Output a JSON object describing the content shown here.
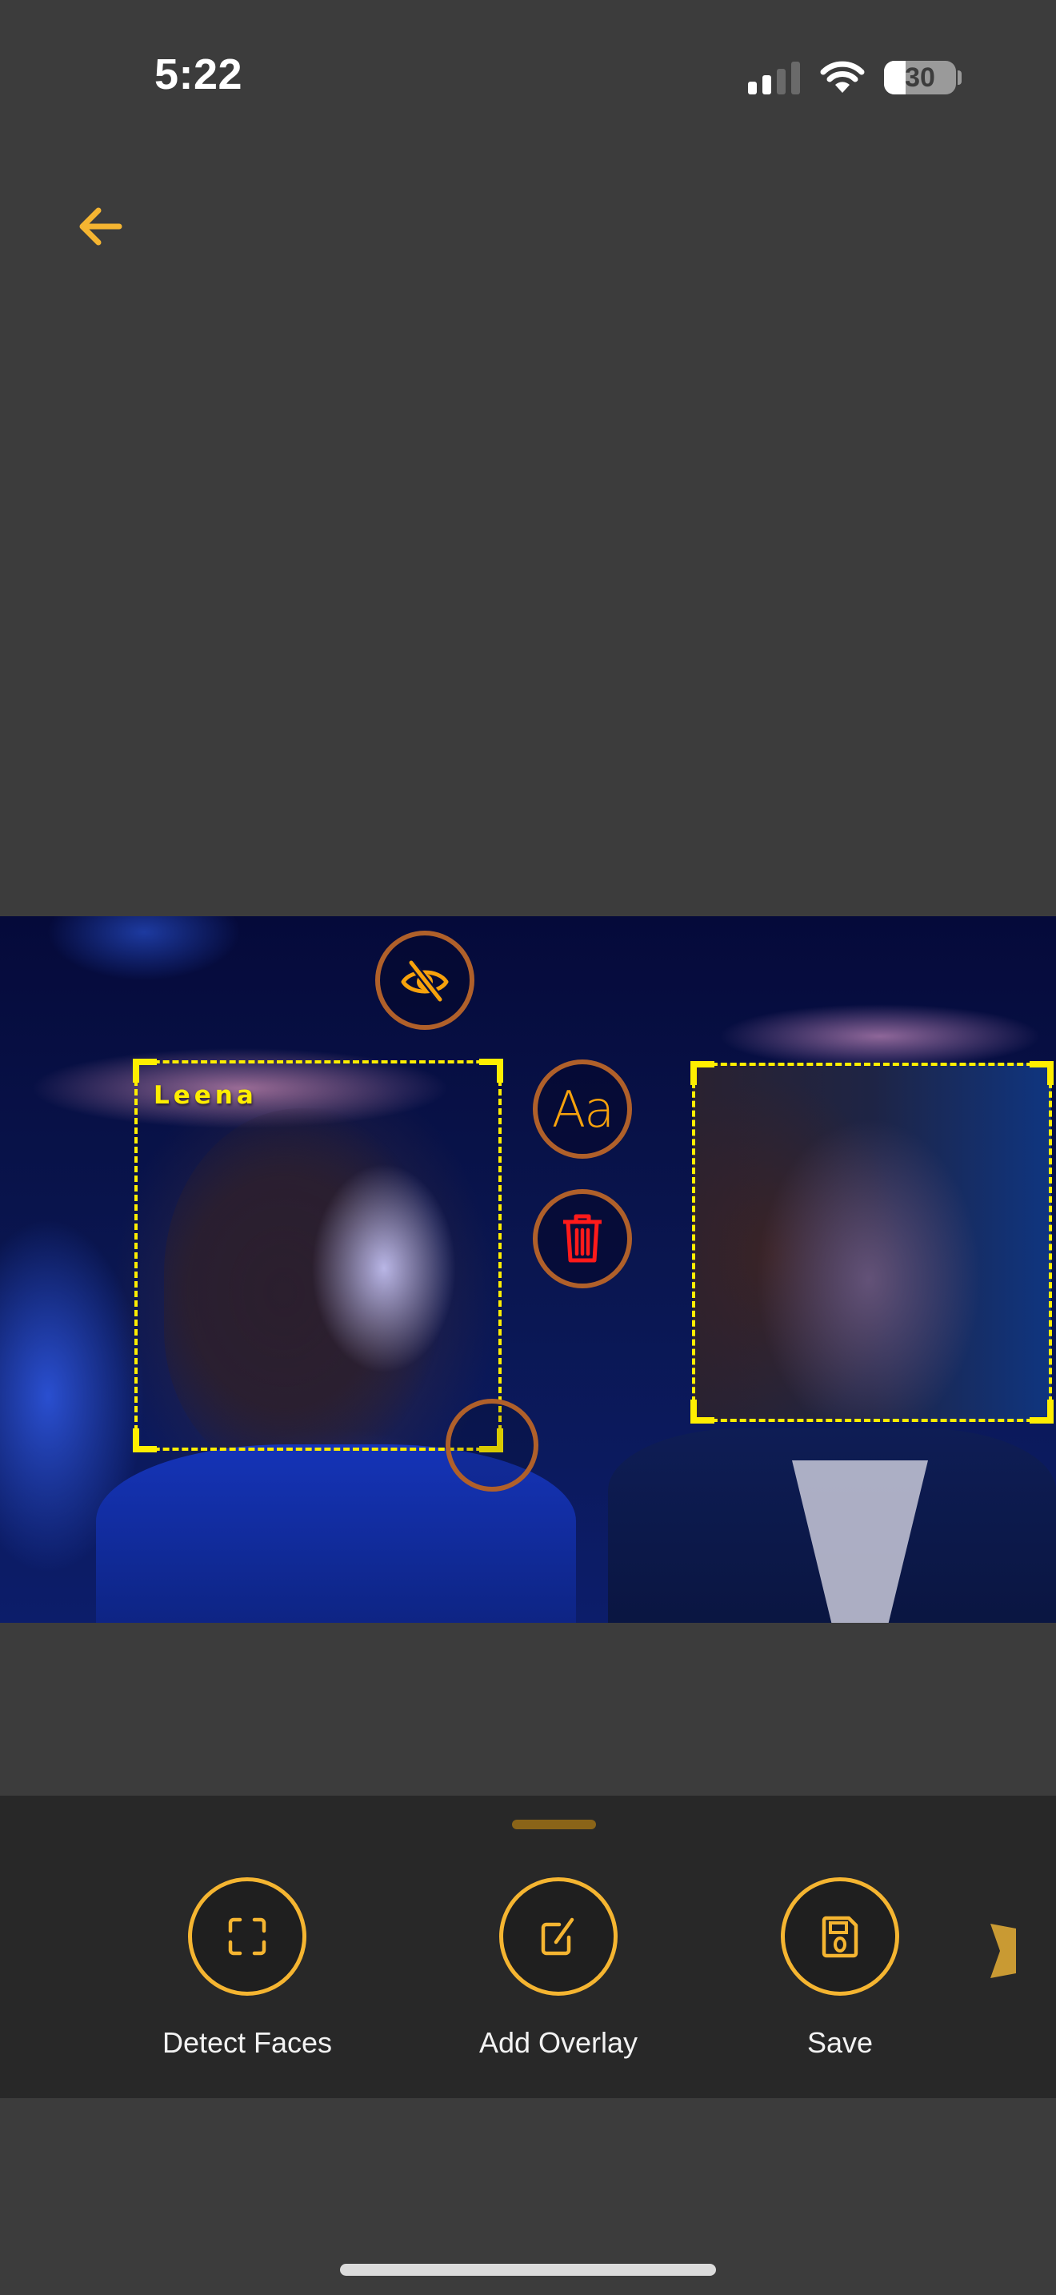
{
  "status_bar": {
    "time": "5:22",
    "signal_bars_active": 2,
    "signal_bars_total": 4,
    "wifi_icon": "wifi-icon",
    "battery_percent": 30,
    "battery_text": "30"
  },
  "header": {
    "back_icon": "arrow-left-icon"
  },
  "editor": {
    "faces": [
      {
        "label": "Leena",
        "state": "labeled",
        "selected": true
      },
      {
        "label": "",
        "state": "blurred",
        "selected": false
      }
    ],
    "face_actions": {
      "toggle_visibility_icon": "eye-slash-icon",
      "text_style_label": "Aa",
      "delete_icon": "trash-icon",
      "resize_handle_icon": "resize-handle"
    }
  },
  "toolbar": {
    "items": [
      {
        "label": "Detect Faces",
        "icon": "face-scan-icon"
      },
      {
        "label": "Add Overlay",
        "icon": "edit-square-icon"
      },
      {
        "label": "Save",
        "icon": "floppy-disk-icon"
      }
    ],
    "more_icon": "chevron-right-icon"
  },
  "colors": {
    "accent": "#F5B531",
    "face_box": "#FFEE00",
    "delete": "#FF1A1A",
    "action_ring": "#B0602A",
    "background": "#3C3C3C",
    "panel": "#282828"
  }
}
